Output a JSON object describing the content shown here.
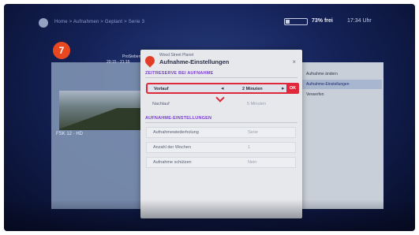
{
  "topbar": {
    "breadcrumb": "Home > Aufnahmen > Geplant > Serie 3",
    "free_space": "73% frei",
    "time": "17:34 Uhr"
  },
  "background": {
    "channel_logo": "7",
    "channel_name": "ProSieben",
    "time_range": "20:15 - 21:15",
    "meta": "FSK 12 · HD"
  },
  "right_panel": {
    "items": [
      "Aufnahme ändern",
      "Aufnahme-Einstellungen",
      "Verwerfen"
    ]
  },
  "dialog": {
    "channel": "Wood Street Planet",
    "title": "Aufnahme-Einstellungen",
    "close_label": "×",
    "section1": "ZEITRESERVE BEI AUFNAHME",
    "vorlauf_label": "Vorlauf",
    "vorlauf_value": "2 Minuten",
    "ok_label": "OK",
    "nachlauf_label": "Nachlauf",
    "nachlauf_value": "5 Minuten",
    "section2": "AUFNAHME-EINSTELLUNGEN",
    "settings": [
      {
        "label": "Aufnahmewiederholung",
        "value": "Serie"
      },
      {
        "label": "Anzahl der Wochen",
        "value": "1"
      },
      {
        "label": "Aufnahme schützen",
        "value": "Nein"
      }
    ]
  },
  "colors": {
    "accent": "#e0283a",
    "section_header": "#7a3fd1",
    "background_blue": "#142258"
  },
  "icons": {
    "settings": "gear-icon",
    "storage": "storage-icon",
    "dialog": "record-icon",
    "left": "arrow-left-icon",
    "right": "arrow-right-icon",
    "down": "chevron-down-icon"
  }
}
